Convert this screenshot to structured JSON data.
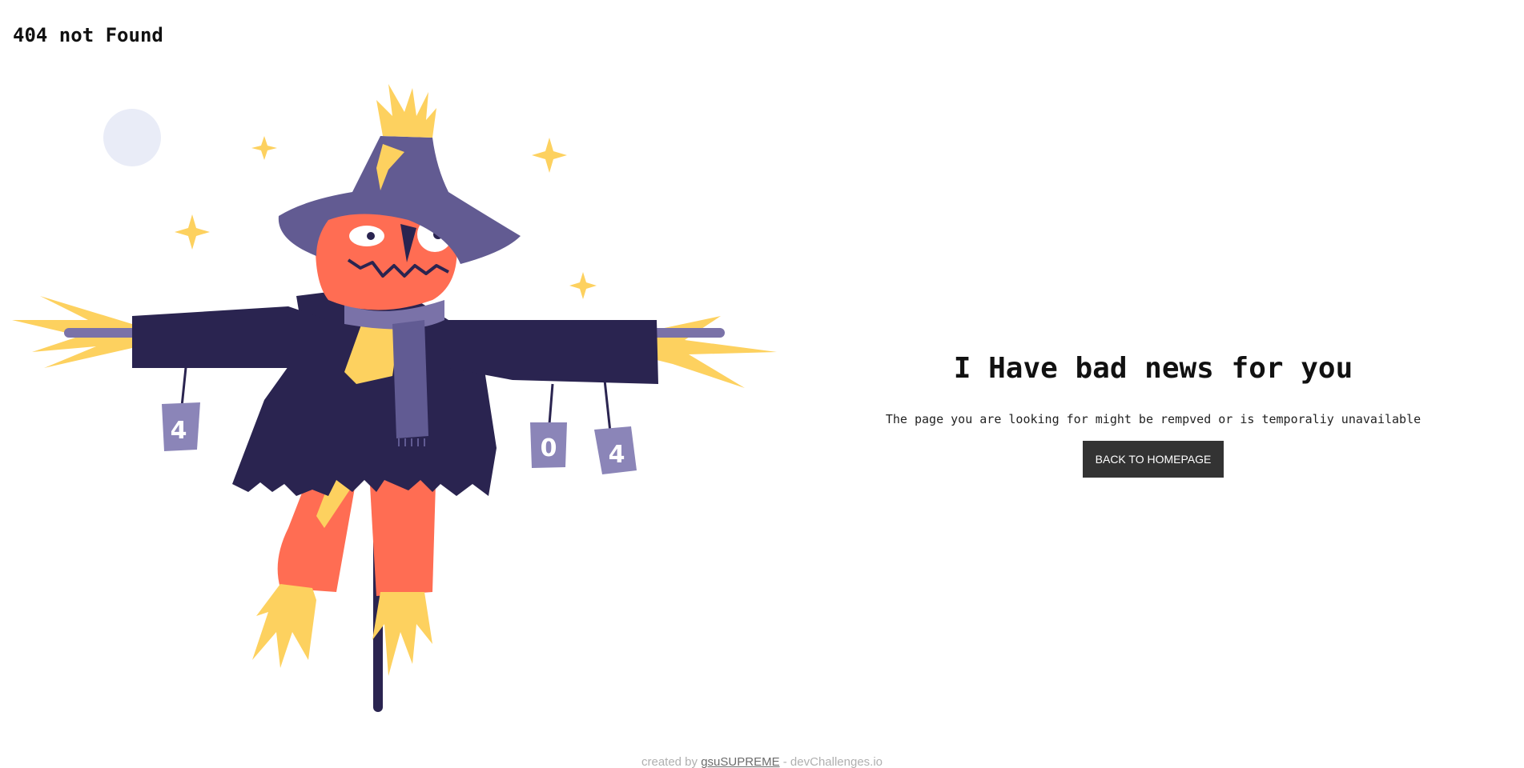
{
  "header": {
    "brand": "404 not Found"
  },
  "illustration": {
    "can_labels": [
      "4",
      "0",
      "4"
    ],
    "colors": {
      "coat": "#2a2450",
      "hat": "#625b92",
      "straw": "#fdd15f",
      "pants": "#ff6d53",
      "scarf": "#615b93",
      "can": "#8b85b8",
      "moon": "#e9ecf7"
    }
  },
  "main": {
    "headline": "I Have bad news for you",
    "description": "The page you are looking for might be rempved or is temporaliy unavailable",
    "button_label": "BACK TO HOMEPAGE"
  },
  "footer": {
    "prefix": "created by",
    "author": "gsuSUPREME",
    "separator": " - ",
    "site": "devChallenges.io"
  }
}
